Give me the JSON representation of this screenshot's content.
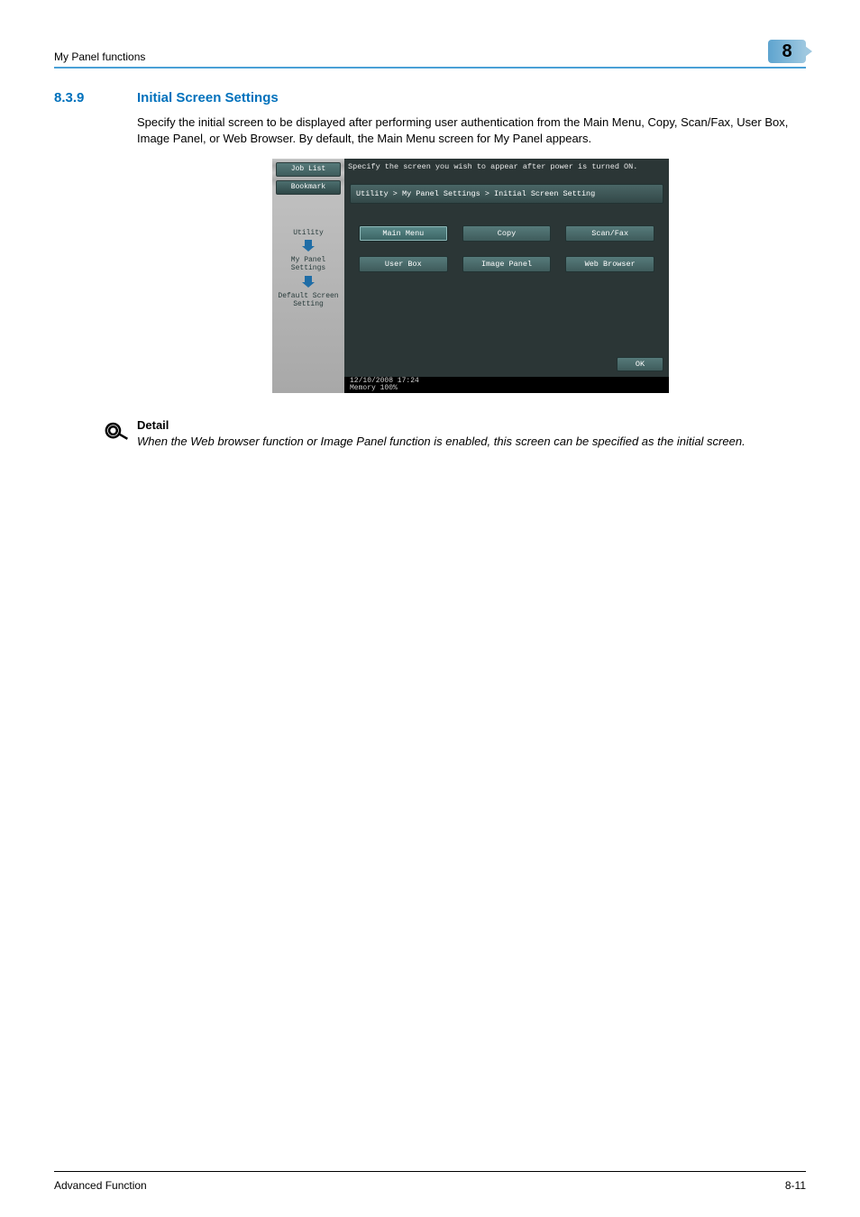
{
  "header": {
    "running_title": "My Panel functions",
    "chapter_number": "8"
  },
  "section": {
    "number": "8.3.9",
    "title": "Initial Screen Settings",
    "paragraph": "Specify the initial screen to be displayed after performing user authentication from the Main Menu, Copy, Scan/Fax, User Box, Image Panel, or Web Browser. By default, the Main Menu screen for My Panel appears."
  },
  "panel": {
    "side_buttons": {
      "job_list": "Job List",
      "bookmark": "Bookmark"
    },
    "side_labels": {
      "utility": "Utility",
      "my_panel_settings": "My Panel\nSettings",
      "default_screen_setting": "Default Screen\nSetting"
    },
    "message": "Specify the screen you wish to appear after power is turned ON.",
    "breadcrumb": "Utility > My Panel Settings > Initial Screen Setting",
    "options": {
      "main_menu": "Main Menu",
      "copy": "Copy",
      "scan_fax": "Scan/Fax",
      "user_box": "User Box",
      "image_panel": "Image Panel",
      "web_browser": "Web Browser"
    },
    "ok": "OK",
    "footer": {
      "datetime": "12/10/2008   17:24",
      "memory": "Memory       100%"
    }
  },
  "detail": {
    "label": "Detail",
    "text": "When the Web browser function or Image Panel function is enabled, this screen can be specified as the initial screen."
  },
  "footer": {
    "doc_title": "Advanced Function",
    "page_number": "8-11"
  }
}
